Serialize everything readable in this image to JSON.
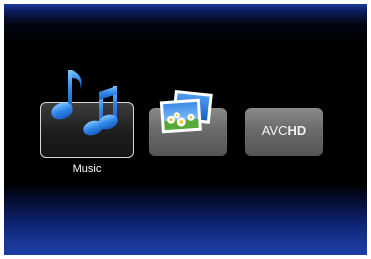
{
  "menu": {
    "items": [
      {
        "id": "music",
        "label": "Music",
        "icon": "music-notes-icon",
        "selected": true
      },
      {
        "id": "photo",
        "label": "",
        "icon": "photo-icon",
        "selected": false
      },
      {
        "id": "avchd",
        "label": "",
        "icon": "avchd-logo",
        "selected": false
      }
    ],
    "avchd_logo_text": {
      "prefix": "AVC",
      "suffix": "HD"
    }
  },
  "colors": {
    "top_gradient": "#1a3d9c",
    "bottom_gradient": "#1c3fa6",
    "note_blue": "#2f86e8",
    "tile_selected": "#1d1d1d",
    "tile_idle": "#6b6b6b"
  }
}
